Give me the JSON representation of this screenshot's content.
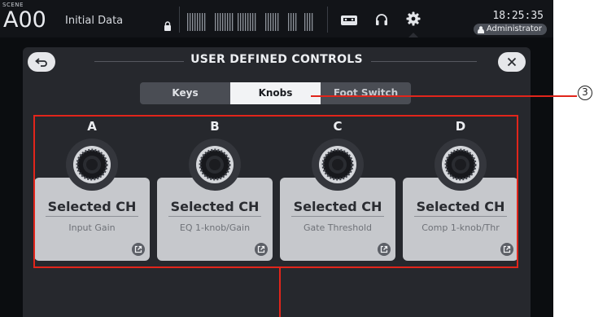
{
  "statusbar": {
    "scene_label": "SCENE",
    "scene_number": "A00",
    "scene_title": "Initial Data",
    "clock": "18:25:35",
    "user": "Administrator"
  },
  "dialog": {
    "title": "USER DEFINED CONTROLS",
    "tabs": [
      {
        "label": "Keys",
        "active": false
      },
      {
        "label": "Knobs",
        "active": true
      },
      {
        "label": "Foot Switch",
        "active": false
      }
    ]
  },
  "knobs": [
    {
      "letter": "A",
      "name": "Selected CH",
      "param": "Input Gain"
    },
    {
      "letter": "B",
      "name": "Selected CH",
      "param": "EQ 1-knob/Gain"
    },
    {
      "letter": "C",
      "name": "Selected CH",
      "param": "Gate Threshold"
    },
    {
      "letter": "D",
      "name": "Selected CH",
      "param": "Comp 1-knob/Thr"
    }
  ],
  "annotation": {
    "callout": "3"
  },
  "colors": {
    "annotation_red": "#e1251b",
    "card": "#c6c8cc",
    "dialog": "#26282d"
  }
}
